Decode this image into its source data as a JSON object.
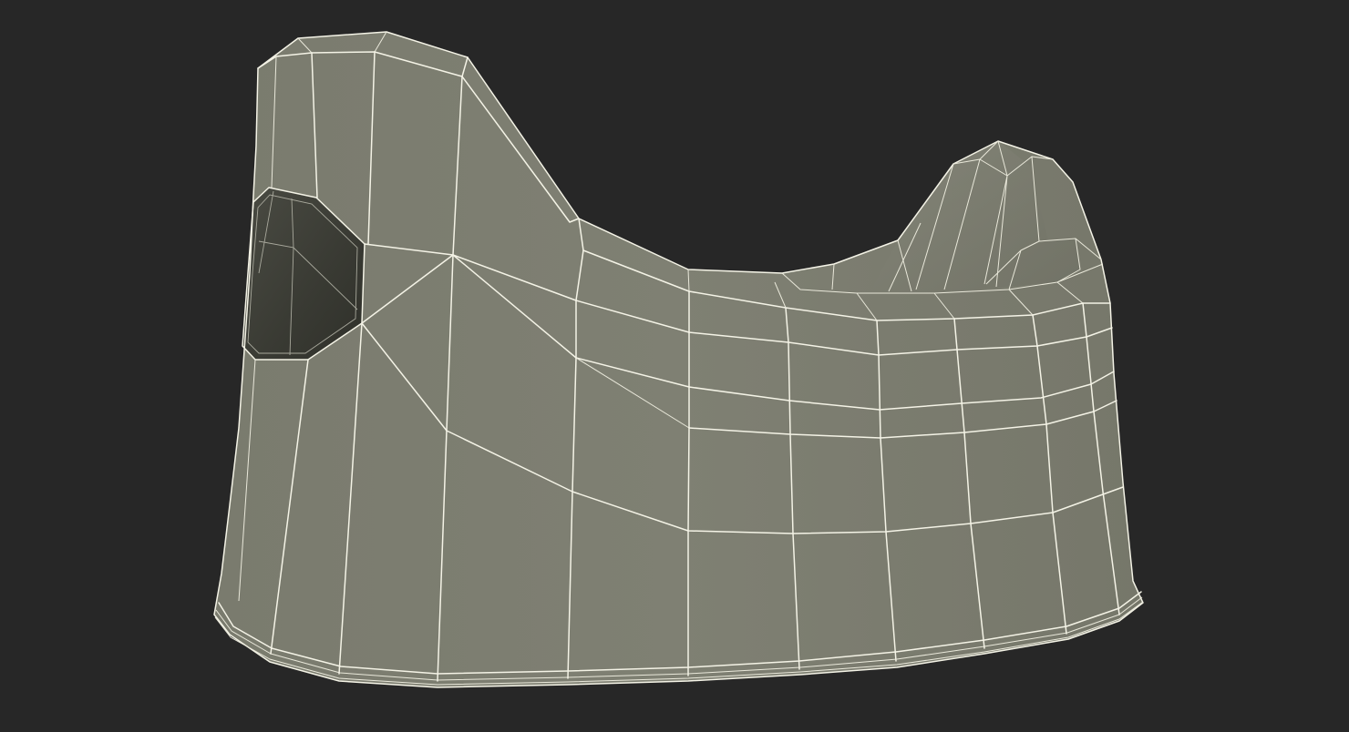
{
  "scene": {
    "subject": "3d-wireframe-potty-seat",
    "background_color": "#272727",
    "body_color": "#7d7e71",
    "body_shade_color": "#6f7064",
    "wire_color": "#f4f3e6",
    "opening_color": "#3a3b34"
  }
}
